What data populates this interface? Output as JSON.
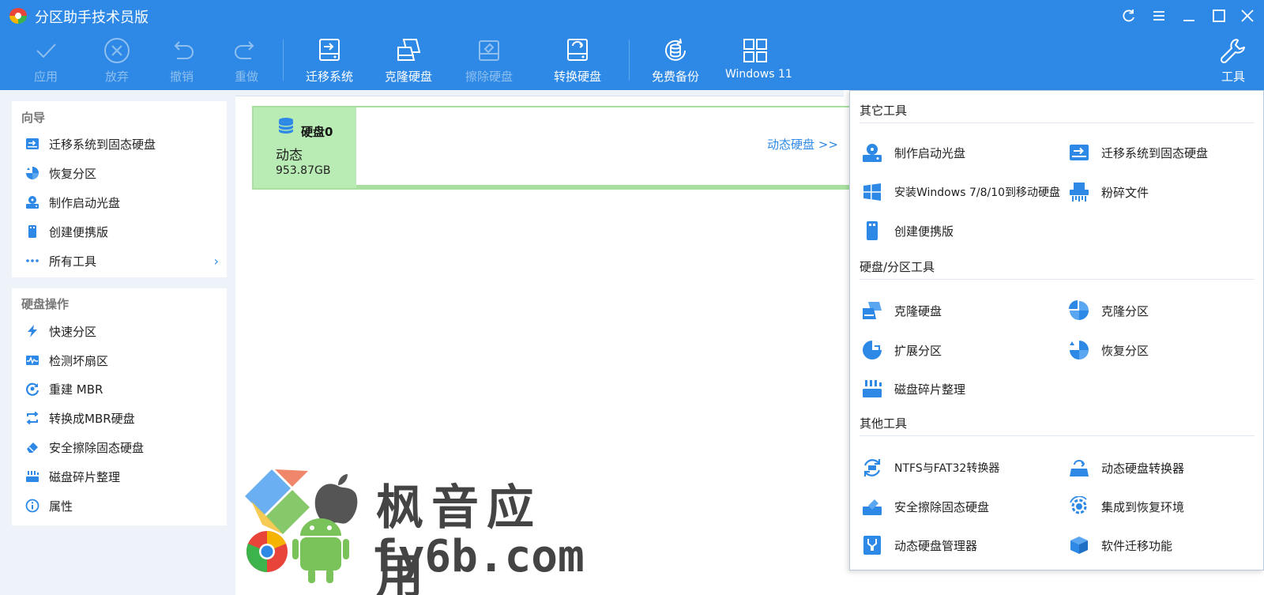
{
  "app": {
    "title": "分区助手技术员版"
  },
  "toolbar": {
    "apply": "应用",
    "discard": "放弃",
    "undo": "撤销",
    "redo": "重做",
    "migrate_os": "迁移系统",
    "clone_disk": "克隆硬盘",
    "wipe_disk": "擦除硬盘",
    "convert_disk": "转换硬盘",
    "free_backup": "免费备份",
    "windows11": "Windows 11",
    "tools": "工具"
  },
  "wizard": {
    "title": "向导",
    "items": [
      {
        "label": "迁移系统到固态硬盘",
        "icon": "migrate-ssd-icon"
      },
      {
        "label": "恢复分区",
        "icon": "recover-partition-icon"
      },
      {
        "label": "制作启动光盘",
        "icon": "boot-disc-icon"
      },
      {
        "label": "创建便携版",
        "icon": "portable-icon"
      },
      {
        "label": "所有工具",
        "icon": "more-icon"
      }
    ]
  },
  "disk_ops": {
    "title": "硬盘操作",
    "items": [
      {
        "label": "快速分区",
        "icon": "lightning-icon"
      },
      {
        "label": "检测坏扇区",
        "icon": "bad-sector-icon"
      },
      {
        "label": "重建 MBR",
        "icon": "rebuild-mbr-icon"
      },
      {
        "label": "转换成MBR硬盘",
        "icon": "convert-mbr-icon"
      },
      {
        "label": "安全擦除固态硬盘",
        "icon": "erase-ssd-icon"
      },
      {
        "label": "磁盘碎片整理",
        "icon": "defrag-icon"
      },
      {
        "label": "属性",
        "icon": "info-icon"
      }
    ]
  },
  "disk": {
    "name": "硬盘0",
    "type": "动态",
    "size": "953.87GB",
    "link": "动态硬盘 >>"
  },
  "tools_menu": {
    "section1": "其它工具",
    "section1_items": [
      {
        "label": "制作启动光盘",
        "icon": "boot-disc-icon"
      },
      {
        "label": "迁移系统到固态硬盘",
        "icon": "migrate-ssd-icon"
      },
      {
        "label": "安装Windows 7/8/10到移动硬盘",
        "icon": "windows-icon"
      },
      {
        "label": "粉碎文件",
        "icon": "shred-icon"
      },
      {
        "label": "创建便携版",
        "icon": "portable-icon"
      }
    ],
    "section2": "硬盘/分区工具",
    "section2_items": [
      {
        "label": "克隆硬盘",
        "icon": "clone-disk-icon"
      },
      {
        "label": "克隆分区",
        "icon": "clone-partition-icon"
      },
      {
        "label": "扩展分区",
        "icon": "extend-partition-icon"
      },
      {
        "label": "恢复分区",
        "icon": "recover-partition-icon"
      },
      {
        "label": "磁盘碎片整理",
        "icon": "defrag-icon"
      }
    ],
    "section3": "其他工具",
    "section3_items": [
      {
        "label": "NTFS与FAT32转换器",
        "icon": "ntfs-fat-icon"
      },
      {
        "label": "动态硬盘转换器",
        "icon": "dynamic-convert-icon"
      },
      {
        "label": "安全擦除固态硬盘",
        "icon": "erase-ssd-icon"
      },
      {
        "label": "集成到恢复环境",
        "icon": "recovery-env-icon"
      },
      {
        "label": "动态硬盘管理器",
        "icon": "dynamic-manager-icon"
      },
      {
        "label": "软件迁移功能",
        "icon": "app-migrate-icon"
      }
    ]
  },
  "watermark": {
    "line1": "枫音应用",
    "line2": "fy6b.com"
  },
  "colors": {
    "accent": "#2e89e6",
    "disk_green": "#b9ecb4",
    "disk_border": "#a9e0a2"
  }
}
